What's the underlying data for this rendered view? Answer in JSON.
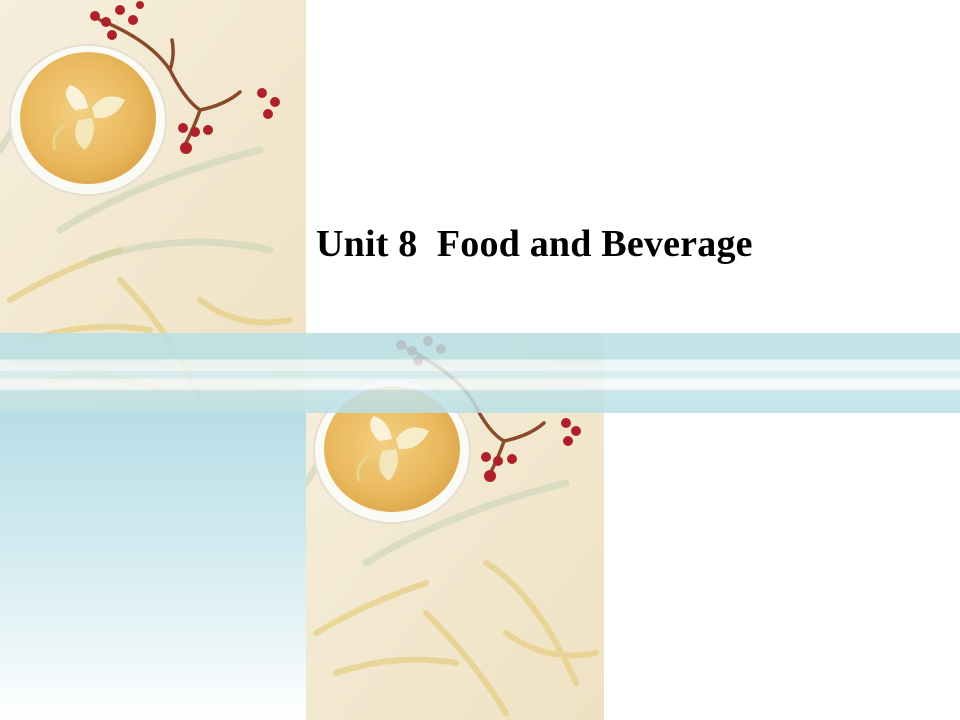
{
  "slide": {
    "title": "Unit 8  Food and Beverage"
  },
  "colors": {
    "parchment": "#f3e8cf",
    "tea": "#e8b85a",
    "berry": "#b0202a",
    "band": "#b8dfe6"
  },
  "decorations": {
    "image": "tea-bowl-with-flower-and-red-berries",
    "icons": [
      "tea-bowl-icon",
      "flower-icon",
      "berry-branch-icon",
      "bamboo-leaf-icon"
    ]
  }
}
